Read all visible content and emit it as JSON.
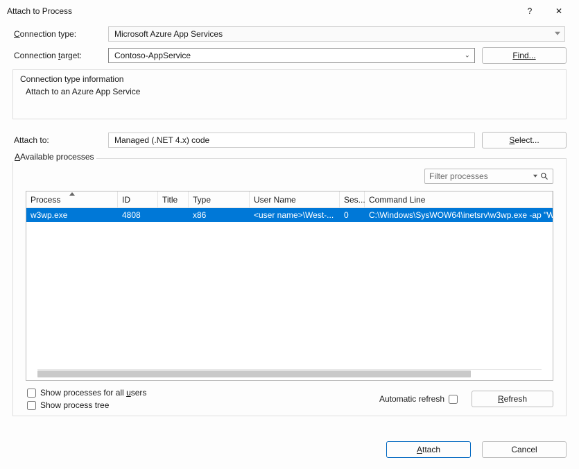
{
  "window": {
    "title": "Attach to Process",
    "help_symbol": "?",
    "close_symbol": "✕"
  },
  "labels": {
    "connection_type_pre": "C",
    "connection_type_post": "onnection type:",
    "connection_target": "Connection ",
    "connection_target_mn": "t",
    "connection_target_post": "arget:",
    "attach_to": "Attach to:",
    "available_processes_pre": "",
    "available_processes_post": "Available processes",
    "automatic_refresh": "Automatic refresh"
  },
  "connection": {
    "type": "Microsoft Azure App Services",
    "target": "Contoso-AppService",
    "info_title": "Connection type information",
    "info_detail": "Attach to an Azure App Service"
  },
  "attach": {
    "value": "Managed (.NET 4.x) code"
  },
  "buttons": {
    "find": "Find...",
    "select": "Select...",
    "refresh": "Refresh",
    "attach": "Attach",
    "cancel": "Cancel"
  },
  "filter": {
    "placeholder": "Filter processes"
  },
  "table": {
    "columns": {
      "process": "Process",
      "id": "ID",
      "title": "Title",
      "type": "Type",
      "user": "User Name",
      "session": "Ses...",
      "cmd": "Command Line"
    },
    "rows": [
      {
        "process": "w3wp.exe",
        "id": "4808",
        "title": "",
        "type": "x86",
        "user": "<user name>\\West-...",
        "session": "0",
        "cmd": "C:\\Windows\\SysWOW64\\inetsrv\\w3wp.exe -ap \"W"
      }
    ]
  },
  "checks": {
    "all_users_pre": "Show processes for all ",
    "all_users_mn": "u",
    "all_users_post": "sers",
    "tree": "Show process tree"
  }
}
